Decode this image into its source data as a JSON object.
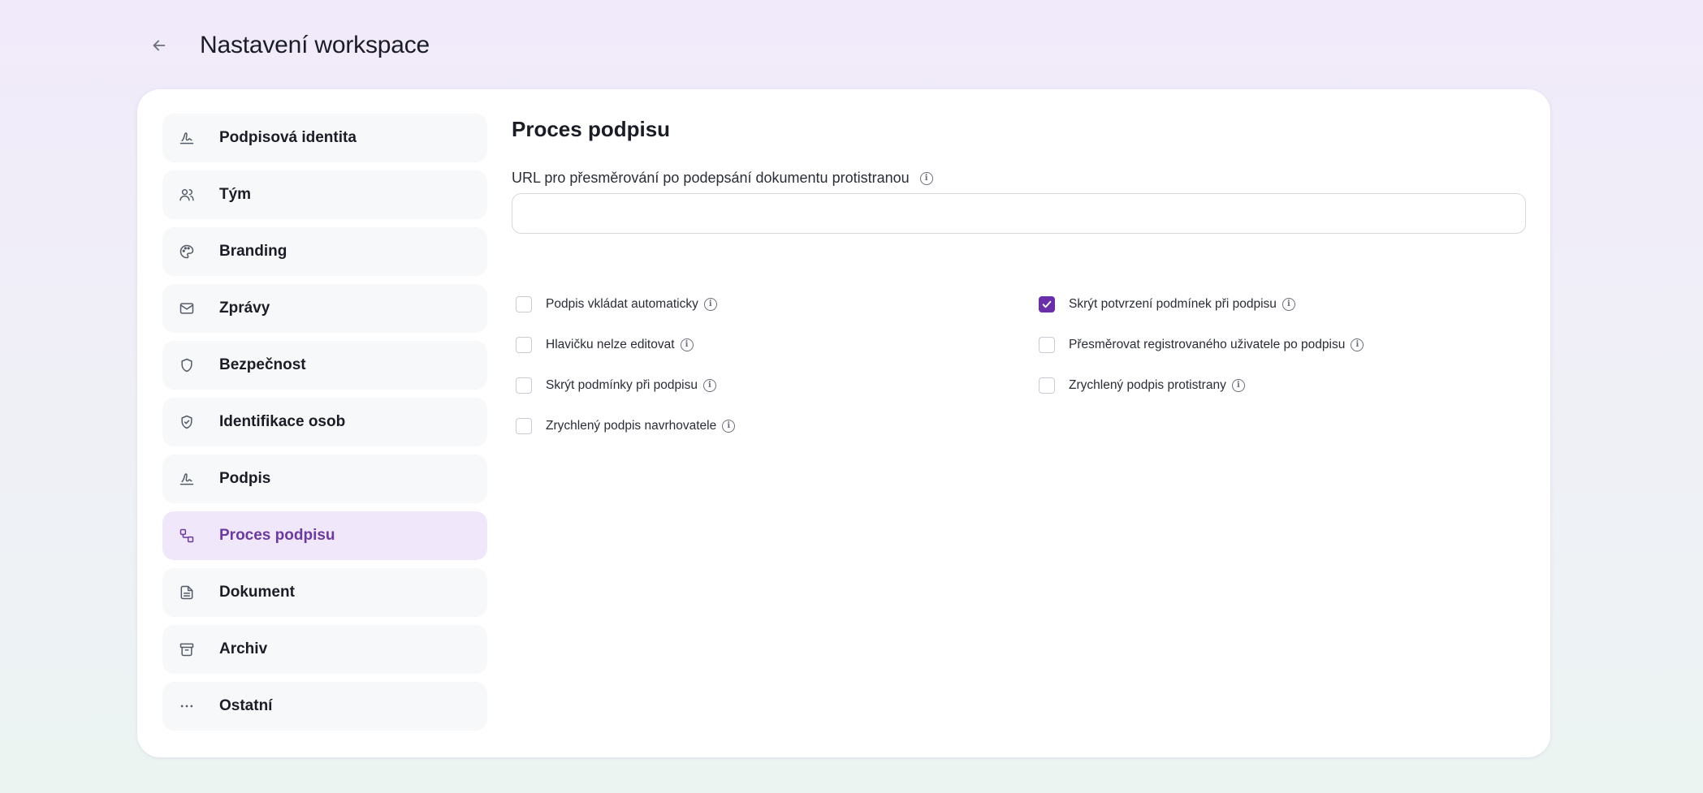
{
  "header": {
    "title": "Nastavení workspace"
  },
  "sidebar": {
    "items": [
      {
        "label": "Podpisová identita",
        "icon": "signature-icon",
        "active": false
      },
      {
        "label": "Tým",
        "icon": "users-icon",
        "active": false
      },
      {
        "label": "Branding",
        "icon": "palette-icon",
        "active": false
      },
      {
        "label": "Zprávy",
        "icon": "mail-icon",
        "active": false
      },
      {
        "label": "Bezpečnost",
        "icon": "shield-icon",
        "active": false
      },
      {
        "label": "Identifikace osob",
        "icon": "shield-check-icon",
        "active": false
      },
      {
        "label": "Podpis",
        "icon": "signature-icon",
        "active": false
      },
      {
        "label": "Proces podpisu",
        "icon": "workflow-icon",
        "active": true
      },
      {
        "label": "Dokument",
        "icon": "file-text-icon",
        "active": false
      },
      {
        "label": "Archiv",
        "icon": "archive-icon",
        "active": false
      },
      {
        "label": "Ostatní",
        "icon": "more-horizontal-icon",
        "active": false
      }
    ]
  },
  "main": {
    "title": "Proces podpisu",
    "url_field": {
      "label": "URL pro přesměrování po podepsání dokumentu protistranou",
      "value": "",
      "placeholder": ""
    },
    "options": [
      {
        "label": "Podpis vkládat automaticky",
        "checked": false
      },
      {
        "label": "Skrýt potvrzení podmínek při podpisu",
        "checked": true
      },
      {
        "label": "Hlavičku nelze editovat",
        "checked": false
      },
      {
        "label": "Přesměrovat registrovaného uživatele po podpisu",
        "checked": false
      },
      {
        "label": "Skrýt podmínky při podpisu",
        "checked": false
      },
      {
        "label": "Zrychlený podpis protistrany",
        "checked": false
      },
      {
        "label": "Zrychlený podpis navrhovatele",
        "checked": false
      }
    ]
  },
  "colors": {
    "accent": "#6a2fa8",
    "active_nav_bg": "#f1e7fa",
    "nav_bg": "#f7f8fa"
  }
}
